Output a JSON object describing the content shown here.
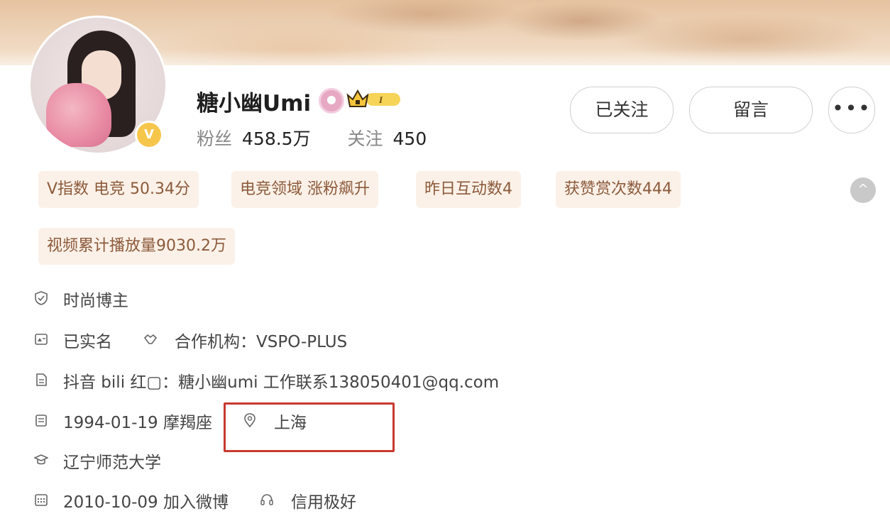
{
  "profile": {
    "name": "糖小幽Umi",
    "fans_label": "粉丝",
    "fans_value": "458.5万",
    "following_label": "关注",
    "following_value": "450",
    "verified_badge": "V"
  },
  "actions": {
    "follow_label": "已关注",
    "message_label": "留言",
    "more_label": "•••"
  },
  "tags": [
    "V指数 电竞 50.34分",
    "电竞领域 涨粉飙升",
    "昨日互动数4",
    "获赞赏次数444",
    "视频累计播放量9030.2万"
  ],
  "collapse_icon": "^",
  "info": {
    "category": "时尚博主",
    "real_name": "已实名",
    "agency": "合作机构：VSPO-PLUS",
    "bio": "抖音 bili 红▢：糖小幽umi 工作联系138050401@qq.com",
    "birthday": "1994-01-19 摩羯座",
    "location": "上海",
    "school": "辽宁师范大学",
    "joined": "2010-10-09 加入微博",
    "credit": "信用极好"
  },
  "colors": {
    "tag_text": "#8c5a3b",
    "tag_bg": "#fbf1e8",
    "highlight": "#c8392f",
    "vbadge": "#f6c64b"
  }
}
